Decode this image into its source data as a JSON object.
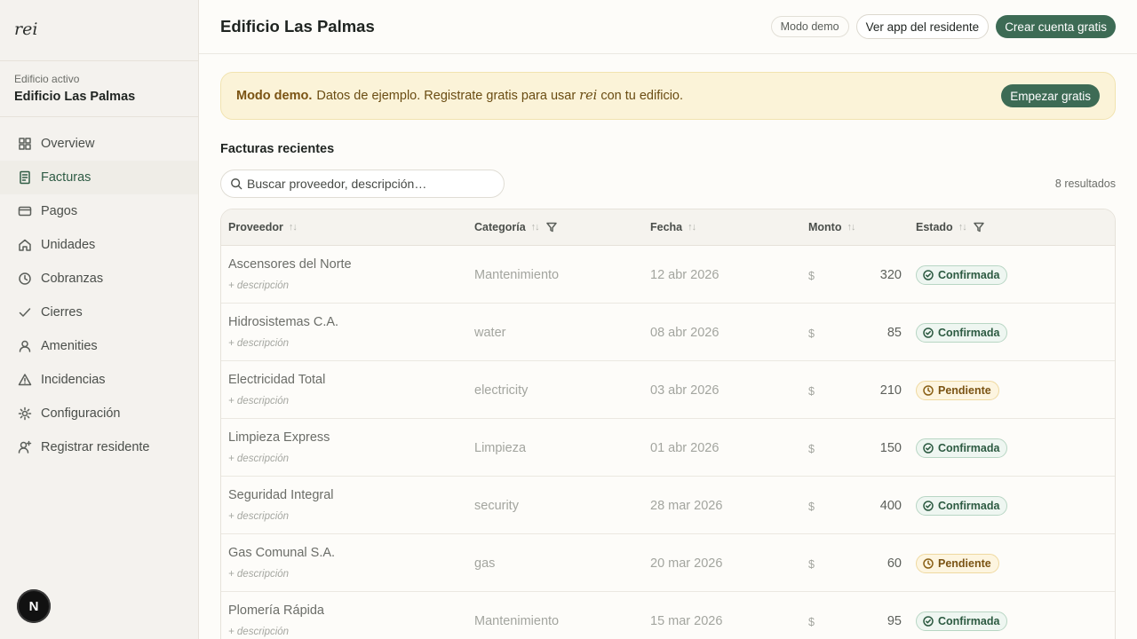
{
  "sidebar": {
    "logo": "rei",
    "active_label": "Edificio activo",
    "active_name": "Edificio Las Palmas",
    "items": [
      {
        "label": "Overview",
        "icon": "grid-icon"
      },
      {
        "label": "Facturas",
        "icon": "document-icon"
      },
      {
        "label": "Pagos",
        "icon": "card-icon"
      },
      {
        "label": "Unidades",
        "icon": "home-icon"
      },
      {
        "label": "Cobranzas",
        "icon": "clock-icon"
      },
      {
        "label": "Cierres",
        "icon": "check-icon"
      },
      {
        "label": "Amenities",
        "icon": "user-icon"
      },
      {
        "label": "Incidencias",
        "icon": "warning-icon"
      },
      {
        "label": "Configuración",
        "icon": "sun-gear-icon"
      },
      {
        "label": "Registrar residente",
        "icon": "user-plus-icon"
      }
    ],
    "active_item": "Facturas",
    "badge": "N"
  },
  "header": {
    "title": "Edificio Las Palmas",
    "demo_label": "Modo demo",
    "resident_app_label": "Ver app del residente",
    "create_account_label": "Crear cuenta gratis"
  },
  "banner": {
    "strong": "Modo demo.",
    "text_before": "Datos de ejemplo. Registrate gratis para usar",
    "brand": "rei",
    "text_after": "con tu edificio.",
    "button": "Empezar gratis"
  },
  "invoices": {
    "title": "Facturas recientes",
    "search_placeholder": "Buscar proveedor, descripción…",
    "results": "8 resultados",
    "columns": {
      "proveedor": "Proveedor",
      "categoria": "Categoría",
      "fecha": "Fecha",
      "monto": "Monto",
      "estado": "Estado"
    },
    "rows": [
      {
        "proveedor": "Ascensores del Norte",
        "descripcion": "+ descripción",
        "categoria": "Mantenimiento",
        "fecha": "12 abr 2026",
        "moneda": "$",
        "monto": "320",
        "estado": "Confirmada",
        "status": "ok"
      },
      {
        "proveedor": "Hidrosistemas C.A.",
        "descripcion": "+ descripción",
        "categoria": "water",
        "fecha": "08 abr 2026",
        "moneda": "$",
        "monto": "85",
        "estado": "Confirmada",
        "status": "ok"
      },
      {
        "proveedor": "Electricidad Total",
        "descripcion": "+ descripción",
        "categoria": "electricity",
        "fecha": "03 abr 2026",
        "moneda": "$",
        "monto": "210",
        "estado": "Pendiente",
        "status": "pend"
      },
      {
        "proveedor": "Limpieza Express",
        "descripcion": "+ descripción",
        "categoria": "Limpieza",
        "fecha": "01 abr 2026",
        "moneda": "$",
        "monto": "150",
        "estado": "Confirmada",
        "status": "ok"
      },
      {
        "proveedor": "Seguridad Integral",
        "descripcion": "+ descripción",
        "categoria": "security",
        "fecha": "28 mar 2026",
        "moneda": "$",
        "monto": "400",
        "estado": "Confirmada",
        "status": "ok"
      },
      {
        "proveedor": "Gas Comunal S.A.",
        "descripcion": "+ descripción",
        "categoria": "gas",
        "fecha": "20 mar 2026",
        "moneda": "$",
        "monto": "60",
        "estado": "Pendiente",
        "status": "pend"
      },
      {
        "proveedor": "Plomería Rápida",
        "descripcion": "+ descripción",
        "categoria": "Mantenimiento",
        "fecha": "15 mar 2026",
        "moneda": "$",
        "monto": "95",
        "estado": "Confirmada",
        "status": "ok"
      }
    ]
  },
  "colors": {
    "accent": "#3d6b55",
    "banner_bg": "#fbf3d8",
    "confirmed": "#2c5a41",
    "pending": "#7a5313"
  }
}
